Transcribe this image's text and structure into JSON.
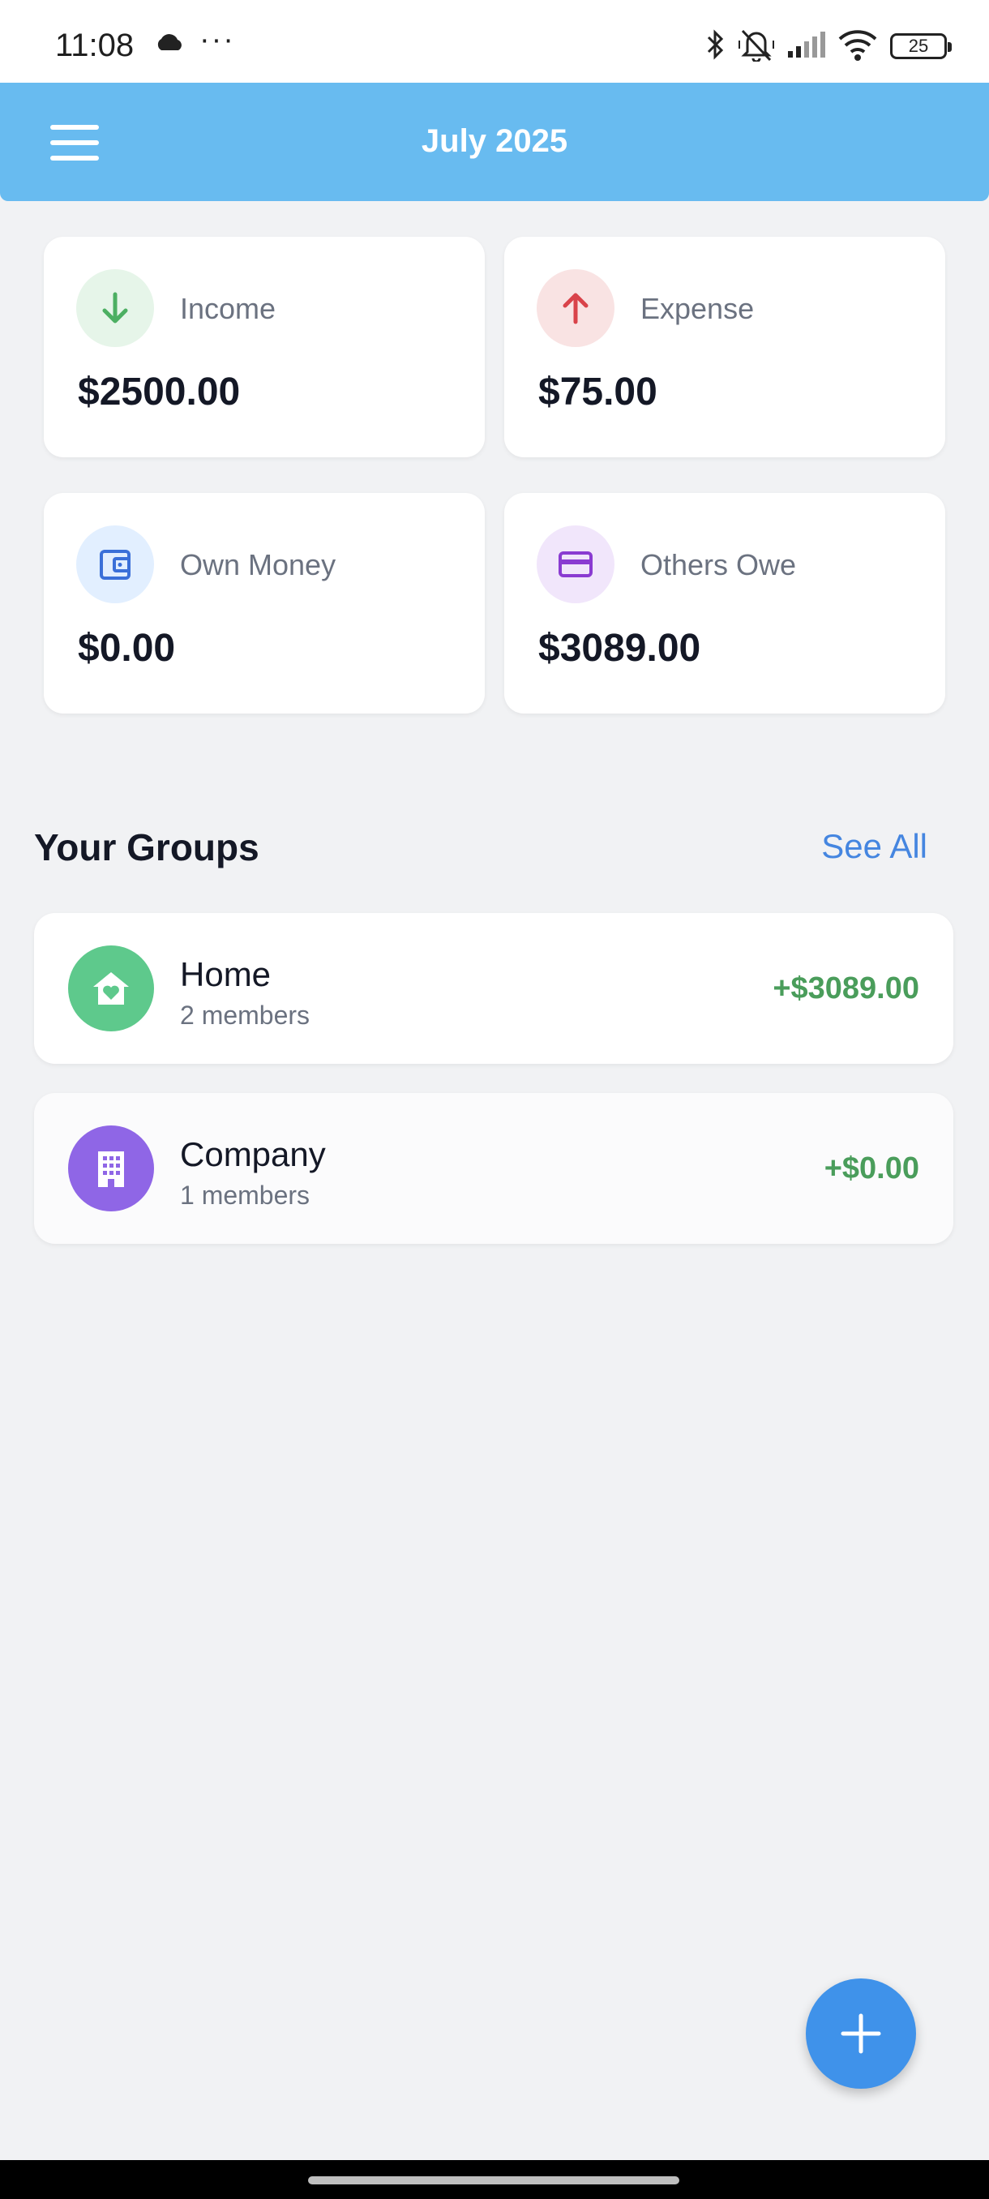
{
  "status_bar": {
    "time": "11:08",
    "more_indicator": "···",
    "battery_level": "25",
    "icons": [
      "cloud-icon",
      "bluetooth-icon",
      "mute-icon",
      "signal-icon",
      "wifi-icon",
      "battery-icon"
    ]
  },
  "header": {
    "title": "July 2025",
    "color": "#68bbf0"
  },
  "summary": {
    "income": {
      "label": "Income",
      "amount": "$2500.00",
      "icon": "arrow-down-icon",
      "color": "#4caf62"
    },
    "expense": {
      "label": "Expense",
      "amount": "$75.00",
      "icon": "arrow-up-icon",
      "color": "#d9434a"
    },
    "own_money": {
      "label": "Own Money",
      "amount": "$0.00",
      "icon": "wallet-icon",
      "color": "#3b70d8"
    },
    "others_owe": {
      "label": "Others Owe",
      "amount": "$3089.00",
      "icon": "credit-card-icon",
      "color": "#8a3bd1"
    }
  },
  "groups": {
    "title": "Your Groups",
    "see_all": "See All",
    "items": [
      {
        "name": "Home",
        "members": "2 members",
        "balance": "+$3089.00",
        "icon": "home-heart-icon",
        "color": "#5ec98c"
      },
      {
        "name": "Company",
        "members": "1 members",
        "balance": "+$0.00",
        "icon": "building-icon",
        "color": "#8f66e6"
      }
    ]
  },
  "fab": {
    "icon": "plus-icon",
    "color": "#3f92ea"
  }
}
